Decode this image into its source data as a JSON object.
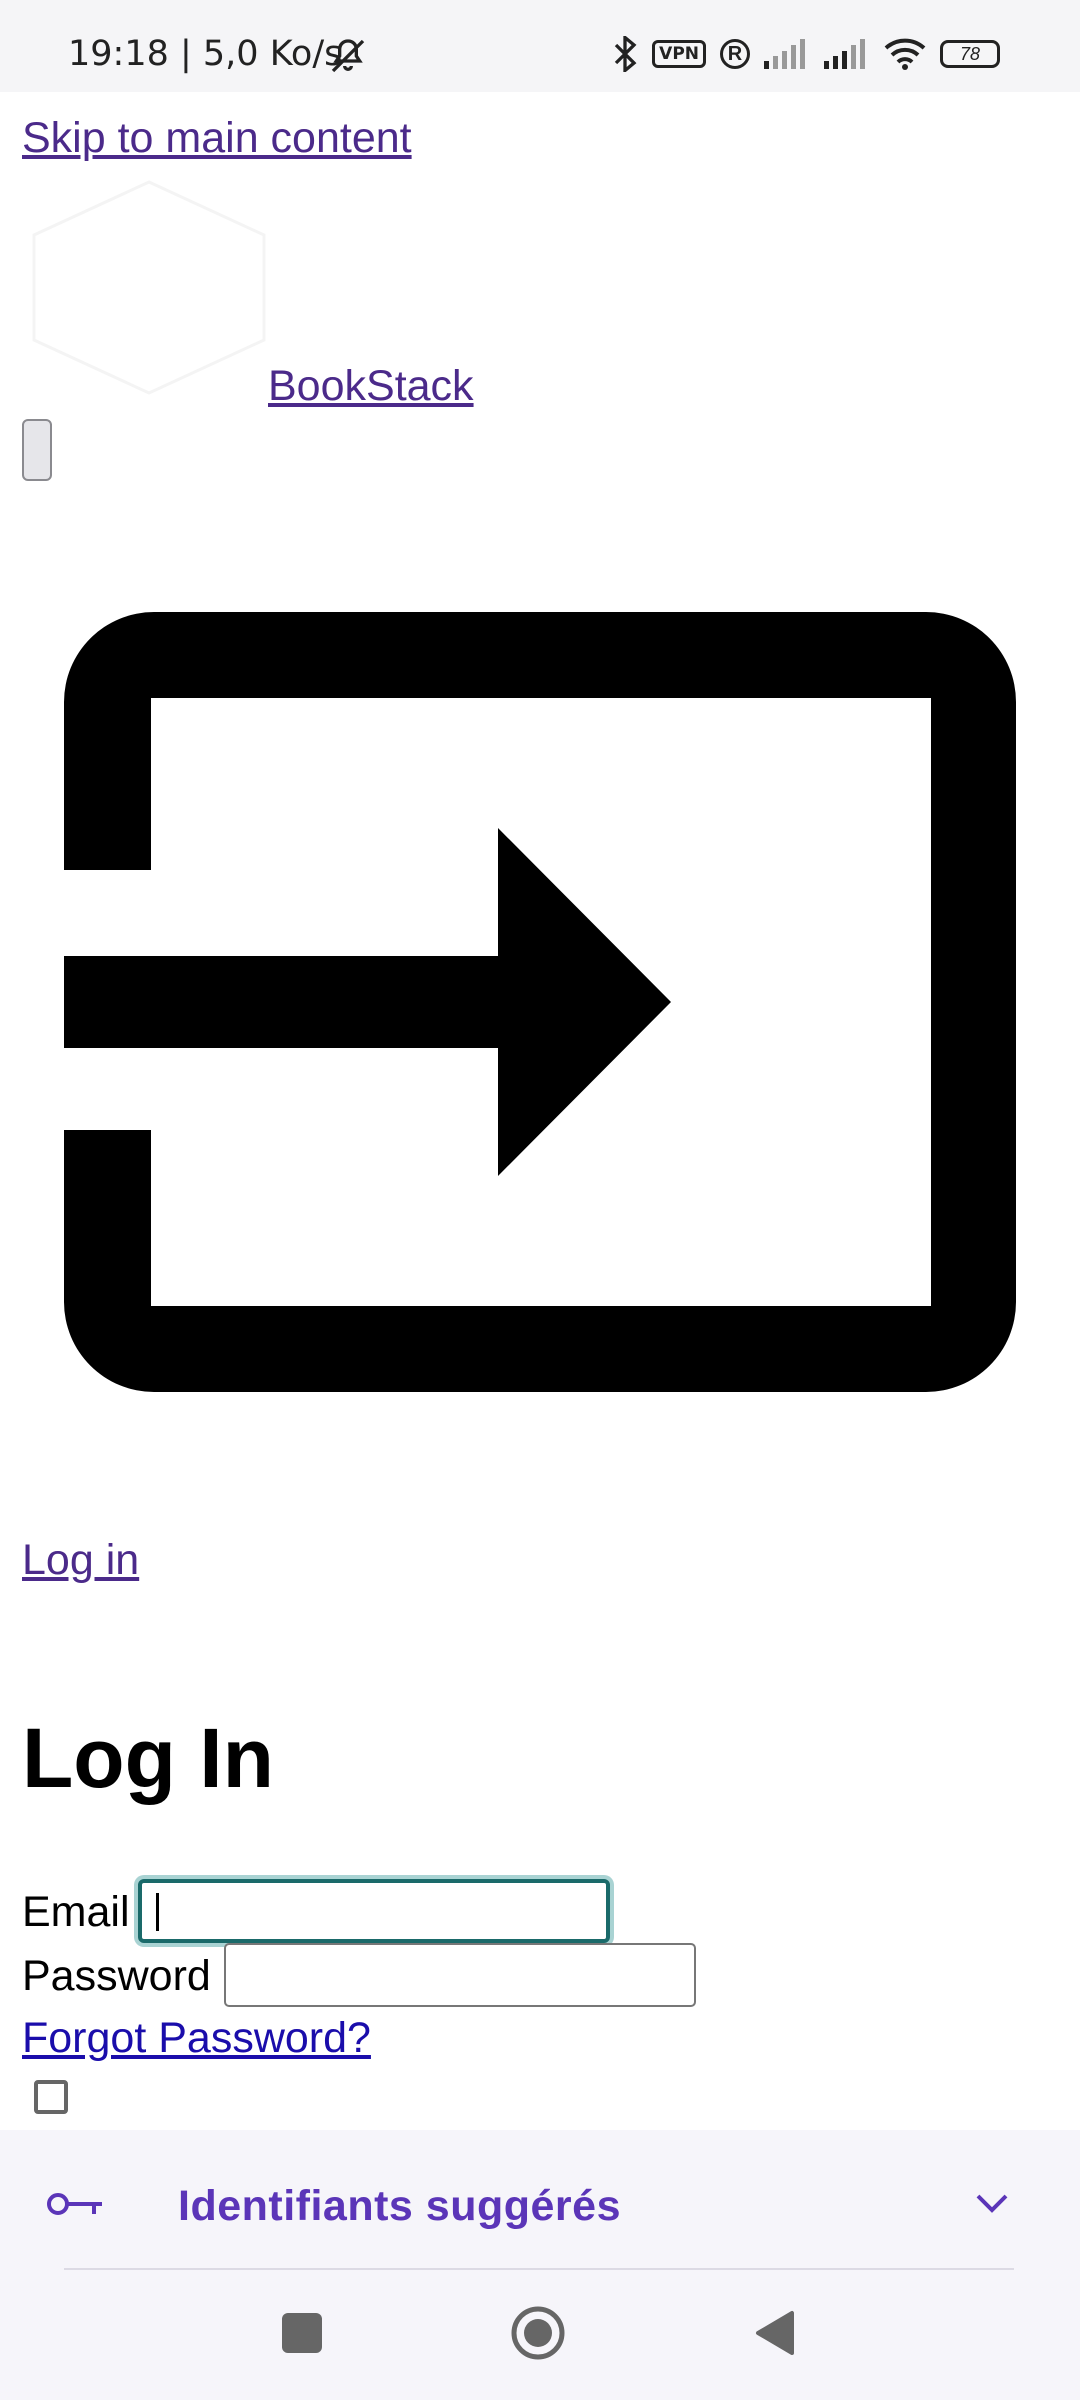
{
  "status_bar": {
    "time_info": "19:18 | 5,0 Ko/s",
    "vpn_label": "VPN",
    "registered_label": "R",
    "battery_level": "78",
    "icons": [
      "bell-off-icon",
      "bluetooth-icon",
      "vpn-icon",
      "registered-icon",
      "signal-icon",
      "signal-icon",
      "wifi-icon",
      "battery-icon"
    ]
  },
  "skip_link": {
    "label": "Skip to main content"
  },
  "header": {
    "brand_label": " BookStack"
  },
  "login_link": {
    "label": "Log in"
  },
  "login_form": {
    "title": "Log In",
    "email_label": "Email",
    "email_value": "",
    "password_label": "Password",
    "password_value": "",
    "forgot_label": "Forgot Password?",
    "remember_checked": false
  },
  "autofill": {
    "label": "Identifiants suggérés"
  },
  "colors": {
    "link": "#4b2a8a",
    "forgot_link": "#1a0dab",
    "focus_ring": "#1a6a6a",
    "autofill_text": "#5b35b8",
    "autofill_bg": "#f6f5fa"
  }
}
